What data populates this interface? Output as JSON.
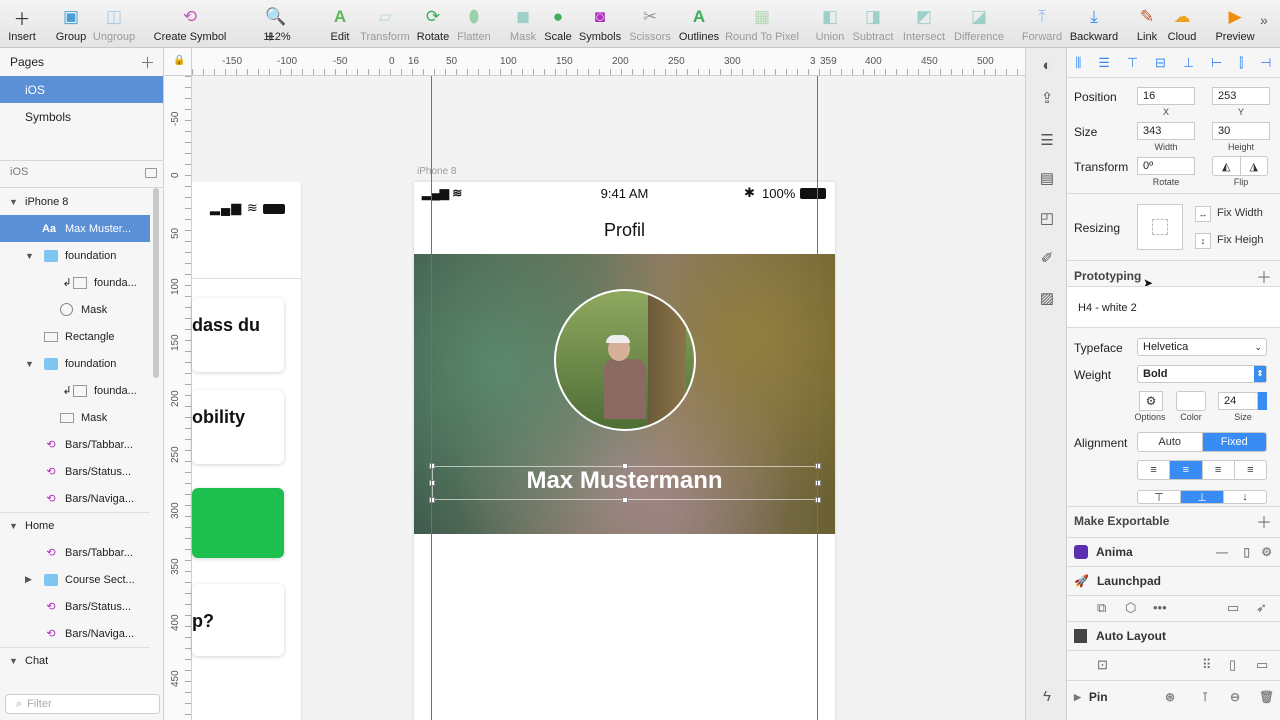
{
  "toolbar": {
    "insert": "Insert",
    "group": "Group",
    "ungroup": "Ungroup",
    "create_symbol": "Create Symbol",
    "zoom": "112%",
    "edit": "Edit",
    "transform": "Transform",
    "rotate": "Rotate",
    "flatten": "Flatten",
    "mask": "Mask",
    "scale": "Scale",
    "symbols": "Symbols",
    "scissors": "Scissors",
    "outlines": "Outlines",
    "round_to_pixel": "Round To Pixel",
    "union": "Union",
    "subtract": "Subtract",
    "intersect": "Intersect",
    "difference": "Difference",
    "forward": "Forward",
    "backward": "Backward",
    "link": "Link",
    "cloud": "Cloud",
    "preview": "Preview"
  },
  "pages": {
    "title": "Pages",
    "items": [
      "iOS",
      "Symbols"
    ]
  },
  "layers": {
    "page_name": "iOS",
    "items": [
      {
        "label": "iPhone 8"
      },
      {
        "label": "Max Muster..."
      },
      {
        "label": "foundation"
      },
      {
        "label": "founda..."
      },
      {
        "label": "Mask"
      },
      {
        "label": "Rectangle"
      },
      {
        "label": "foundation"
      },
      {
        "label": "founda..."
      },
      {
        "label": "Mask"
      },
      {
        "label": "Bars/Tabbar..."
      },
      {
        "label": "Bars/Status..."
      },
      {
        "label": "Bars/Naviga..."
      },
      {
        "label": "Home"
      },
      {
        "label": "Bars/Tabbar..."
      },
      {
        "label": "Course Sect..."
      },
      {
        "label": "Bars/Status..."
      },
      {
        "label": "Bars/Naviga..."
      },
      {
        "label": "Chat"
      }
    ],
    "filter_placeholder": "Filter"
  },
  "ruler": {
    "h": [
      "-150",
      "-100",
      "-50",
      "0",
      "16",
      "50",
      "100",
      "150",
      "200",
      "250",
      "300",
      "3",
      "359",
      "400",
      "450",
      "500"
    ],
    "v": [
      "-50",
      "0",
      "50",
      "100",
      "150",
      "200",
      "250",
      "300",
      "350",
      "400",
      "450"
    ]
  },
  "artboard": {
    "name": "iPhone 8",
    "time": "9:41 AM",
    "battery": "100%",
    "nav_title": "Profil",
    "profile_name": "Max Mustermann",
    "cards": [
      "dass du",
      "obility",
      "",
      "p?"
    ]
  },
  "inspector": {
    "position_label": "Position",
    "x": "16",
    "y": "253",
    "x_label": "X",
    "y_label": "Y",
    "size_label": "Size",
    "width": "343",
    "height": "30",
    "width_label": "Width",
    "height_label": "Height",
    "transform_label": "Transform",
    "rotate": "0º",
    "rotate_label": "Rotate",
    "flip_label": "Flip",
    "resizing_label": "Resizing",
    "fix_width": "Fix Width",
    "fix_height": "Fix Heigh",
    "prototyping": "Prototyping",
    "text_style": "H4 - white 2",
    "typeface_label": "Typeface",
    "typeface": "Helvetica",
    "weight_label": "Weight",
    "weight": "Bold",
    "options_label": "Options",
    "color_label": "Color",
    "size_value": "24",
    "size_sub": "Size",
    "alignment_label": "Alignment",
    "auto": "Auto",
    "fixed": "Fixed",
    "make_exportable": "Make Exportable",
    "anima": "Anima",
    "launchpad": "Launchpad",
    "auto_layout": "Auto Layout",
    "pin": "Pin"
  },
  "colors": {
    "selection": "#5b8fd6",
    "accent": "#3a8cf5",
    "guide": "#c039c0",
    "green_card": "#1dbf4f"
  }
}
